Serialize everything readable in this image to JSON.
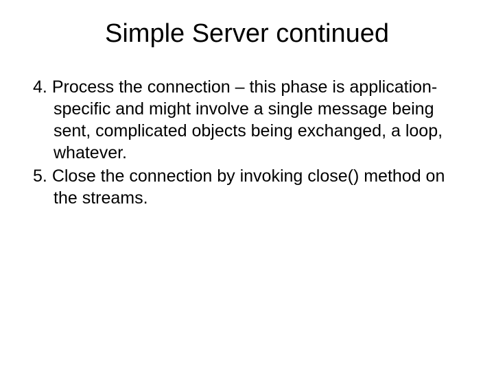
{
  "slide": {
    "title": "Simple Server continued",
    "items": [
      {
        "number": "4.",
        "text": "Process the connection – this phase is application-specific and might involve a single message being sent, complicated objects being exchanged, a loop, whatever."
      },
      {
        "number": "5.",
        "text": "Close the connection by invoking close() method on the streams."
      }
    ]
  }
}
